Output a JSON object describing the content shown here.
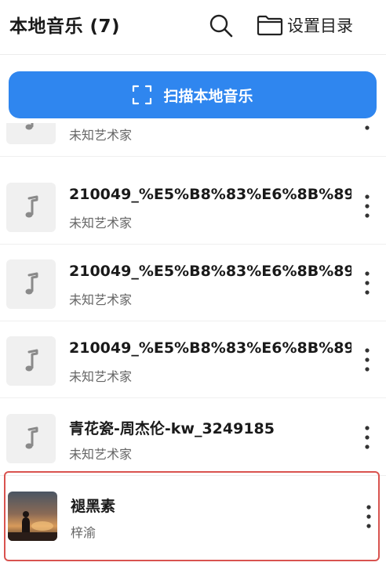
{
  "header": {
    "title": "本地音乐 (7)",
    "set_dir_label": "设置目录"
  },
  "scan_button": {
    "label": "扫描本地音乐"
  },
  "songs": [
    {
      "title": "",
      "artist": "未知艺术家"
    },
    {
      "title": "210049_%E5%B8%83%E6%8B%89...",
      "artist": "未知艺术家"
    },
    {
      "title": "210049_%E5%B8%83%E6%8B%89...",
      "artist": "未知艺术家"
    },
    {
      "title": "210049_%E5%B8%83%E6%8B%89...",
      "artist": "未知艺术家"
    },
    {
      "title": "青花瓷-周杰伦-kw_3249185",
      "artist": "未知艺术家"
    },
    {
      "title": "褪黑素",
      "artist": "梓渝",
      "selected": true
    }
  ],
  "icons": {
    "search": "search-icon",
    "folder": "folder-icon",
    "scan": "scan-icon",
    "note": "music-note-icon",
    "more": "more-vertical-icon"
  },
  "colors": {
    "accent": "#2f86ef",
    "selection_border": "#d9534f"
  }
}
